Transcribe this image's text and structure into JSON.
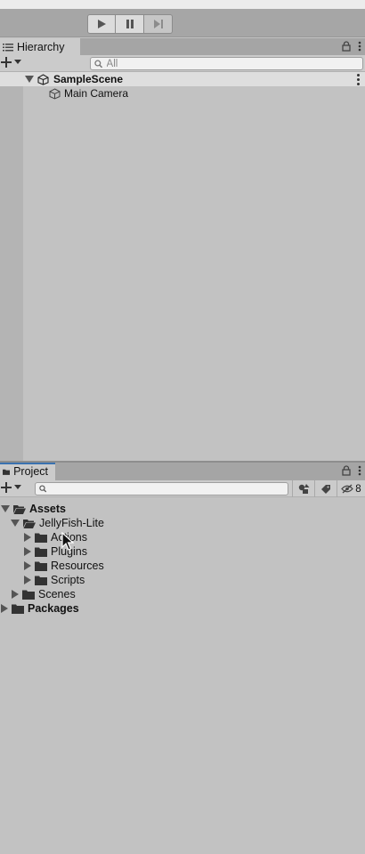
{
  "toolbar": {
    "play_icon": "play-icon",
    "pause_icon": "pause-icon",
    "step_icon": "step-icon"
  },
  "hierarchy": {
    "tab_label": "Hierarchy",
    "search_placeholder": "All",
    "scene_name": "SampleScene",
    "objects": [
      "Main Camera"
    ]
  },
  "project": {
    "tab_label": "Project",
    "search_placeholder": "",
    "hidden_count": "8",
    "tree": {
      "assets": "Assets",
      "jellyfish": "JellyFish-Lite",
      "actions": "Actions",
      "plugins": "Plugins",
      "resources": "Resources",
      "scripts": "Scripts",
      "scenes": "Scenes",
      "packages": "Packages"
    }
  },
  "colors": {
    "active_tab_accent": "#3a72b0",
    "panel_bg": "#c2c2c2"
  }
}
